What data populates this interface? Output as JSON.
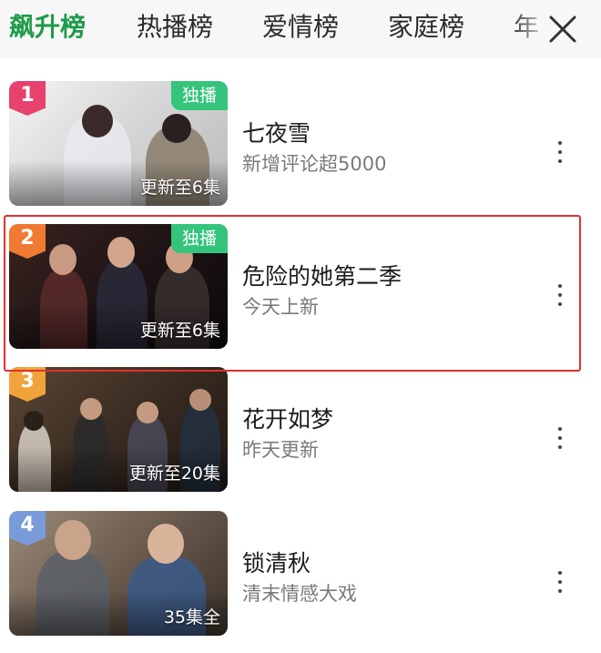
{
  "tabs": {
    "active": "飙升榜",
    "items": [
      "飙升榜",
      "热播榜",
      "爱情榜",
      "家庭榜",
      "年"
    ]
  },
  "icons": {
    "close": "close-icon",
    "more": "more-vertical-icon"
  },
  "colors": {
    "accent": "#1e9b4a",
    "exclusive_badge": "#35c47c",
    "highlight_border": "#e0302f"
  },
  "list": [
    {
      "rank": "1",
      "rank_color": "#e8416d",
      "exclusive": "独播",
      "update": "更新至6集",
      "title": "七夜雪",
      "subtitle": "新增评论超5000"
    },
    {
      "rank": "2",
      "rank_color": "#f07a32",
      "exclusive": "独播",
      "update": "更新至6集",
      "title": "危险的她第二季",
      "subtitle": "今天上新"
    },
    {
      "rank": "3",
      "rank_color": "#f0a33a",
      "exclusive": "",
      "update": "更新至20集",
      "title": "花开如梦",
      "subtitle": "昨天更新"
    },
    {
      "rank": "4",
      "rank_color": "#7a9bd9",
      "exclusive": "",
      "update": "35集全",
      "title": "锁清秋",
      "subtitle": "清末情感大戏"
    }
  ]
}
